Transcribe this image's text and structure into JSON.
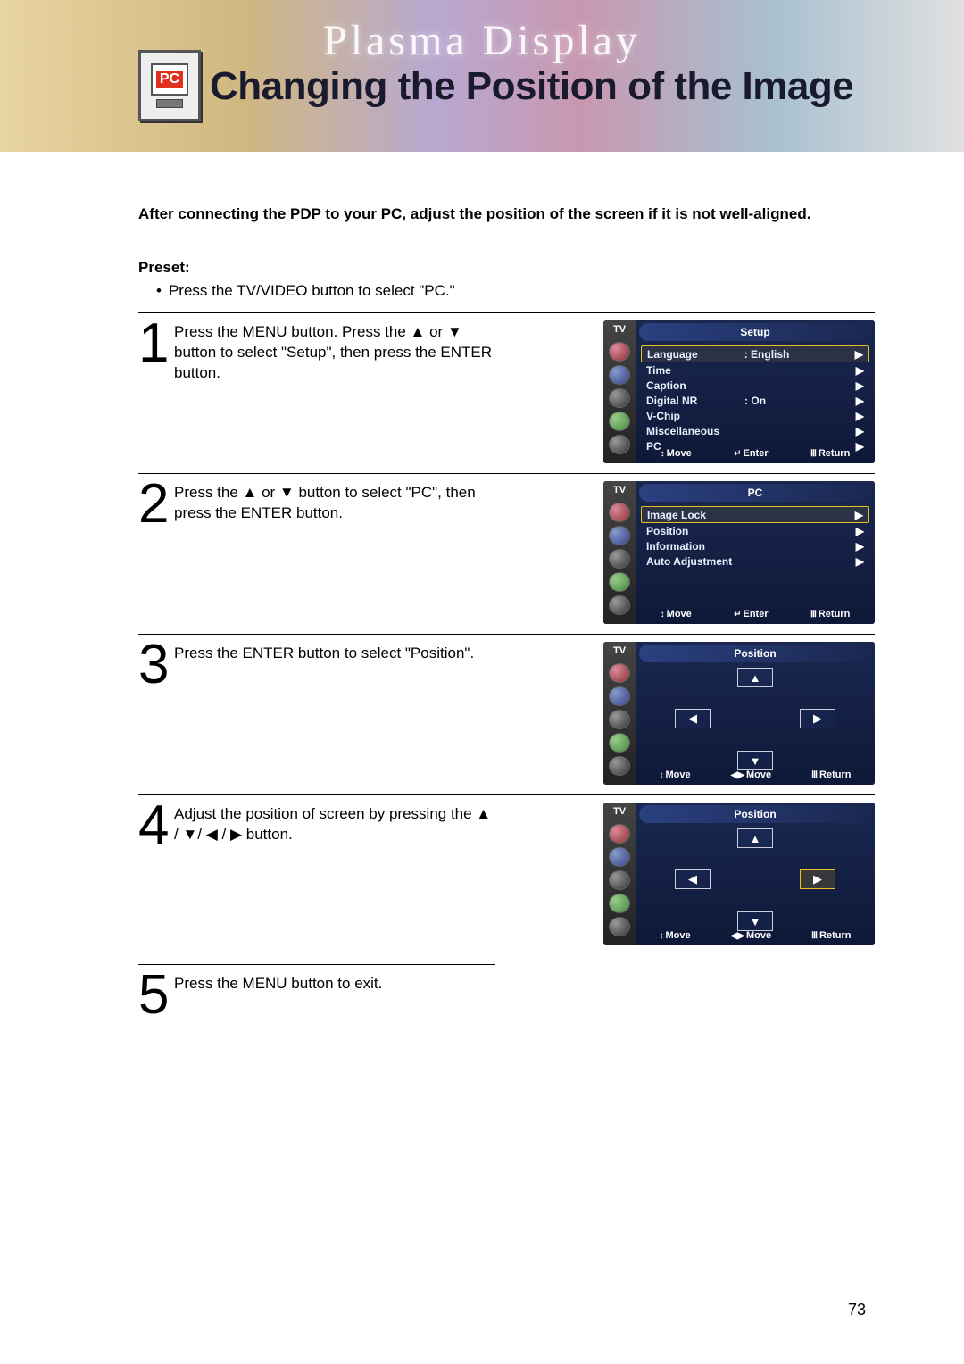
{
  "header": {
    "brand": "Plasma Display",
    "pc_badge": "PC",
    "title": "Changing the Position of the Image"
  },
  "intro": "After connecting the PDP to your PC, adjust the position of the screen if it is not well-aligned.",
  "preset": {
    "label": "Preset:",
    "bullet": "•",
    "text": "Press the TV/VIDEO button to select \"PC.\""
  },
  "steps": [
    {
      "num": "1",
      "text": "Press the MENU button. Press the ▲ or ▼ button to select \"Setup\", then press the ENTER button."
    },
    {
      "num": "2",
      "text": "Press the ▲ or ▼ button to select \"PC\", then press the ENTER button."
    },
    {
      "num": "3",
      "text": "Press the ENTER button to select \"Position\"."
    },
    {
      "num": "4",
      "text": "Adjust the position of screen by pressing the ▲ / ▼/ ◀ / ▶ button."
    },
    {
      "num": "5",
      "text": "Press the MENU button to exit."
    }
  ],
  "osd": {
    "sidebar_label": "TV",
    "footer": {
      "move_ud": "Move",
      "enter": "Enter",
      "return": "Return",
      "move_lr": "Move"
    },
    "setup": {
      "title": "Setup",
      "rows": [
        {
          "label": "Language",
          "value": ": English",
          "arr": "▶",
          "sel": true
        },
        {
          "label": "Time",
          "value": "",
          "arr": "▶"
        },
        {
          "label": "Caption",
          "value": "",
          "arr": "▶"
        },
        {
          "label": "Digital NR",
          "value": ": On",
          "arr": "▶"
        },
        {
          "label": "V-Chip",
          "value": "",
          "arr": "▶"
        },
        {
          "label": "Miscellaneous",
          "value": "",
          "arr": "▶"
        },
        {
          "label": "PC",
          "value": "",
          "arr": "▶"
        }
      ]
    },
    "pc": {
      "title": "PC",
      "rows": [
        {
          "label": "Image Lock",
          "value": "",
          "arr": "▶",
          "sel": true
        },
        {
          "label": "Position",
          "value": "",
          "arr": "▶"
        },
        {
          "label": "Information",
          "value": "",
          "arr": "▶"
        },
        {
          "label": "Auto Adjustment",
          "value": "",
          "arr": "▶"
        }
      ]
    },
    "position": {
      "title": "Position"
    }
  },
  "arrows": {
    "up": "▲",
    "down": "▼",
    "left": "◀",
    "right": "▶",
    "updown": "↕",
    "leftright": "◀▶",
    "enter": "↵",
    "return": "Ⅲ"
  },
  "page": "73"
}
